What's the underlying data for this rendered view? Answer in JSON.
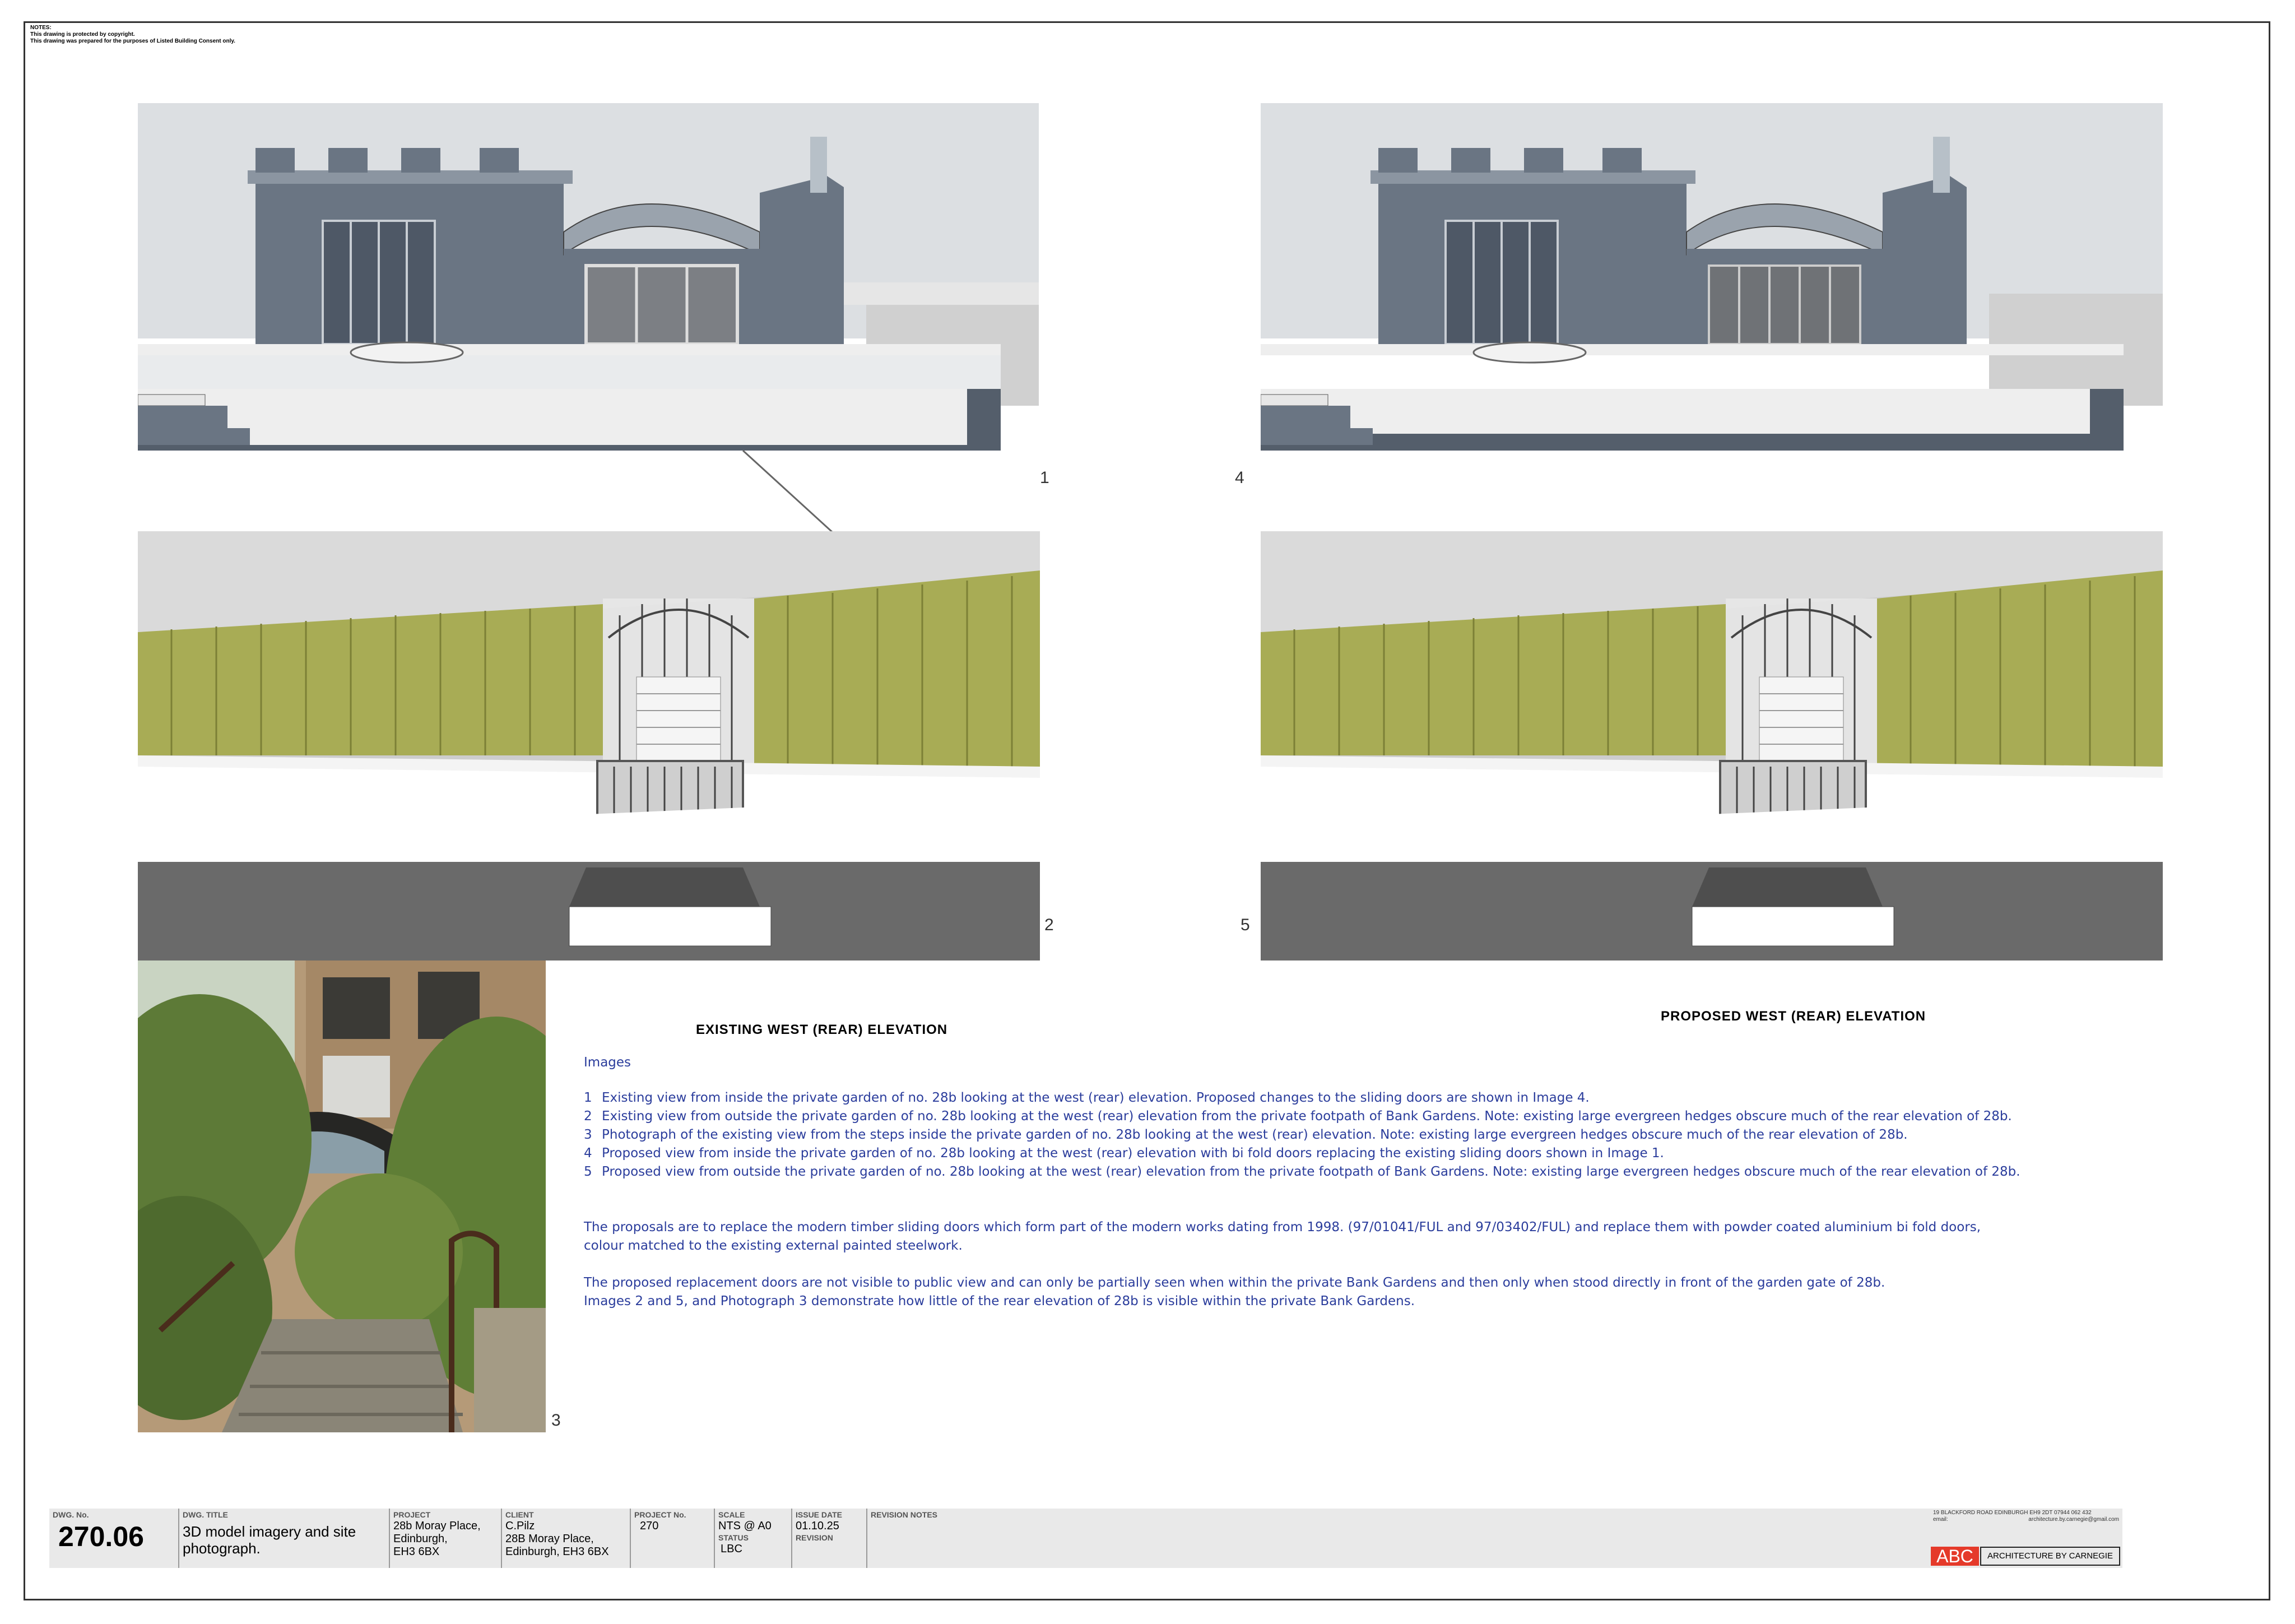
{
  "notes": {
    "heading": "NOTES:",
    "line1": "This drawing is protected by copyright.",
    "line2": "This drawing was prepared for the purposes of Listed Building Consent only."
  },
  "images": {
    "n1": "1",
    "n2": "2",
    "n3": "3",
    "n4": "4",
    "n5": "5"
  },
  "titles": {
    "existing": "EXISTING WEST (REAR) ELEVATION",
    "proposed": "PROPOSED WEST (REAR) ELEVATION"
  },
  "description": {
    "heading": "Images",
    "items": [
      {
        "num": "1",
        "text": "Existing view from inside the private garden of no. 28b looking at the west (rear) elevation. Proposed changes to the sliding doors are shown in Image 4."
      },
      {
        "num": "2",
        "text": "Existing view from outside the private garden of no. 28b looking at the west (rear) elevation from the private footpath of Bank Gardens. Note: existing large evergreen hedges obscure much of the rear elevation of 28b."
      },
      {
        "num": "3",
        "text": "Photograph of the existing view from the steps inside the private garden of no. 28b looking at the west (rear) elevation. Note: existing large evergreen hedges obscure much of the rear elevation of 28b."
      },
      {
        "num": "4",
        "text": "Proposed view from inside the private garden of no. 28b looking at the west (rear) elevation with bi fold doors replacing the existing sliding doors shown in Image 1."
      },
      {
        "num": "5",
        "text": "Proposed view from outside the private garden of no. 28b looking at the west (rear) elevation from the private footpath of Bank Gardens. Note: existing large evergreen hedges obscure much of the rear elevation of 28b."
      }
    ],
    "para1_line1": "The proposals are to replace the modern timber sliding doors which form part of the modern works dating from 1998. (97/01041/FUL and 97/03402/FUL)  and replace them with powder coated aluminium bi fold doors,",
    "para1_line2": "colour matched to the existing external painted steelwork.",
    "para2_line1": "The proposed replacement doors are not visible to public view and can only be partially seen when within the private Bank Gardens and then only when stood directly in front of the garden gate of 28b.",
    "para2_line2": "Images 2 and 5, and Photograph 3 demonstrate how little of the rear elevation of 28b is visible within the private Bank Gardens."
  },
  "title_block": {
    "dwg_no_label": "DWG. No.",
    "dwg_no": "270.06",
    "dwg_title_label": "DWG. TITLE",
    "dwg_title_line1": "3D model imagery and site",
    "dwg_title_line2": "photograph.",
    "project_label": "PROJECT",
    "project_line1": "28b Moray Place,",
    "project_line2": "Edinburgh,",
    "project_line3": "EH3 6BX",
    "client_label": "CLIENT",
    "client_line1": "C.Pilz",
    "client_line2": "28B Moray Place,",
    "client_line3": "Edinburgh, EH3 6BX",
    "project_no_label": "PROJECT No.",
    "project_no": "270",
    "scale_label": "SCALE",
    "scale": "NTS @ A0",
    "status_label": "STATUS",
    "status": "LBC",
    "issue_date_label": "ISSUE DATE",
    "issue_date": "01.10.25",
    "revision_label": "REVISION",
    "revision_notes_label": "REVISION NOTES"
  },
  "firm": {
    "address": "19 BLACKFORD ROAD EDINBURGH EH9 2DT  07944 062 432",
    "email_label": "email:",
    "email": "architecture.by.carnegie@gmail.com",
    "logo": "ABC",
    "name": "ARCHITECTURE BY CARNEGIE"
  },
  "colors": {
    "wall": "#6a7583",
    "wall_dark": "#545e6b",
    "hedge": "#a8ac55",
    "road": "#6a6a6a",
    "text_blue": "#2b3d9c",
    "logo_red": "#e53a2a"
  }
}
